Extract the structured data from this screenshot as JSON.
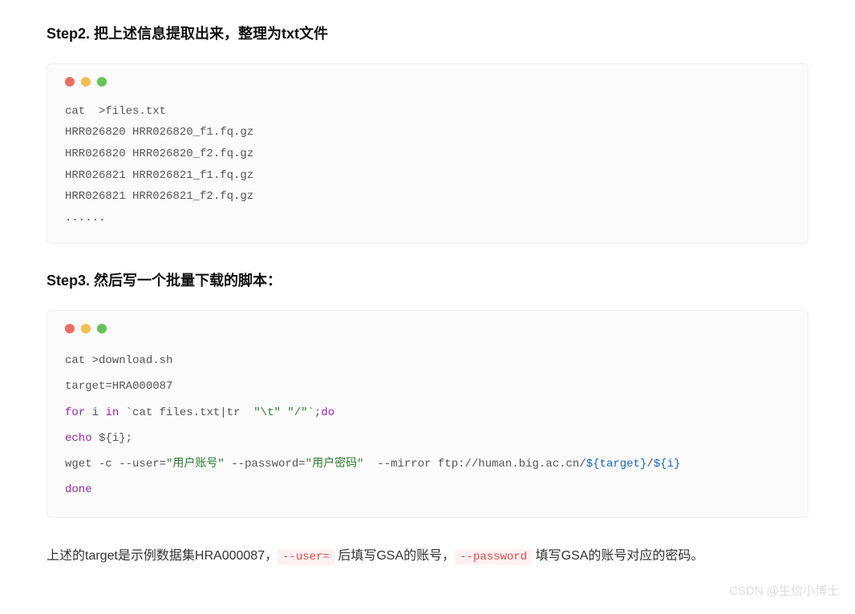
{
  "step2": {
    "heading": "Step2. 把上述信息提取出来，整理为txt文件",
    "code": "cat  >files.txt\nHRR026820 HRR026820_f1.fq.gz\nHRR026820 HRR026820_f2.fq.gz\nHRR026821 HRR026821_f1.fq.gz\nHRR026821 HRR026821_f2.fq.gz\n......"
  },
  "step3": {
    "heading": "Step3. 然后写一个批量下载的脚本：",
    "code": {
      "l1": "cat >download.sh",
      "l2": "target=HRA000087",
      "l3_for": "for",
      "l3_mid": " i ",
      "l3_in": "in",
      "l3_cmd": " `cat files.txt|tr  ",
      "l3_q1": "\"\\t\"",
      "l3_sp": " ",
      "l3_q2": "\"/\"",
      "l3_end": "`;",
      "l3_do": "do",
      "l4_echo": "echo",
      "l4_arg": " ${i};",
      "l5_a": "wget -c --user=",
      "l5_u": "\"用户账号\"",
      "l5_b": " --password=",
      "l5_p": "\"用户密码\"",
      "l5_c": "  --mirror ftp://human.big.ac.cn/",
      "l5_t": "${target}",
      "l5_s": "/",
      "l5_i": "${i}",
      "l6": "done"
    }
  },
  "paragraph": {
    "t1": "上述的target是示例数据集HRA000087，",
    "c1": "--user=",
    "t2": " 后填写GSA的账号，",
    "c2": "--password",
    "t3": " 填写GSA的账号对应的密码。"
  },
  "watermark": "CSDN @生信小博士"
}
